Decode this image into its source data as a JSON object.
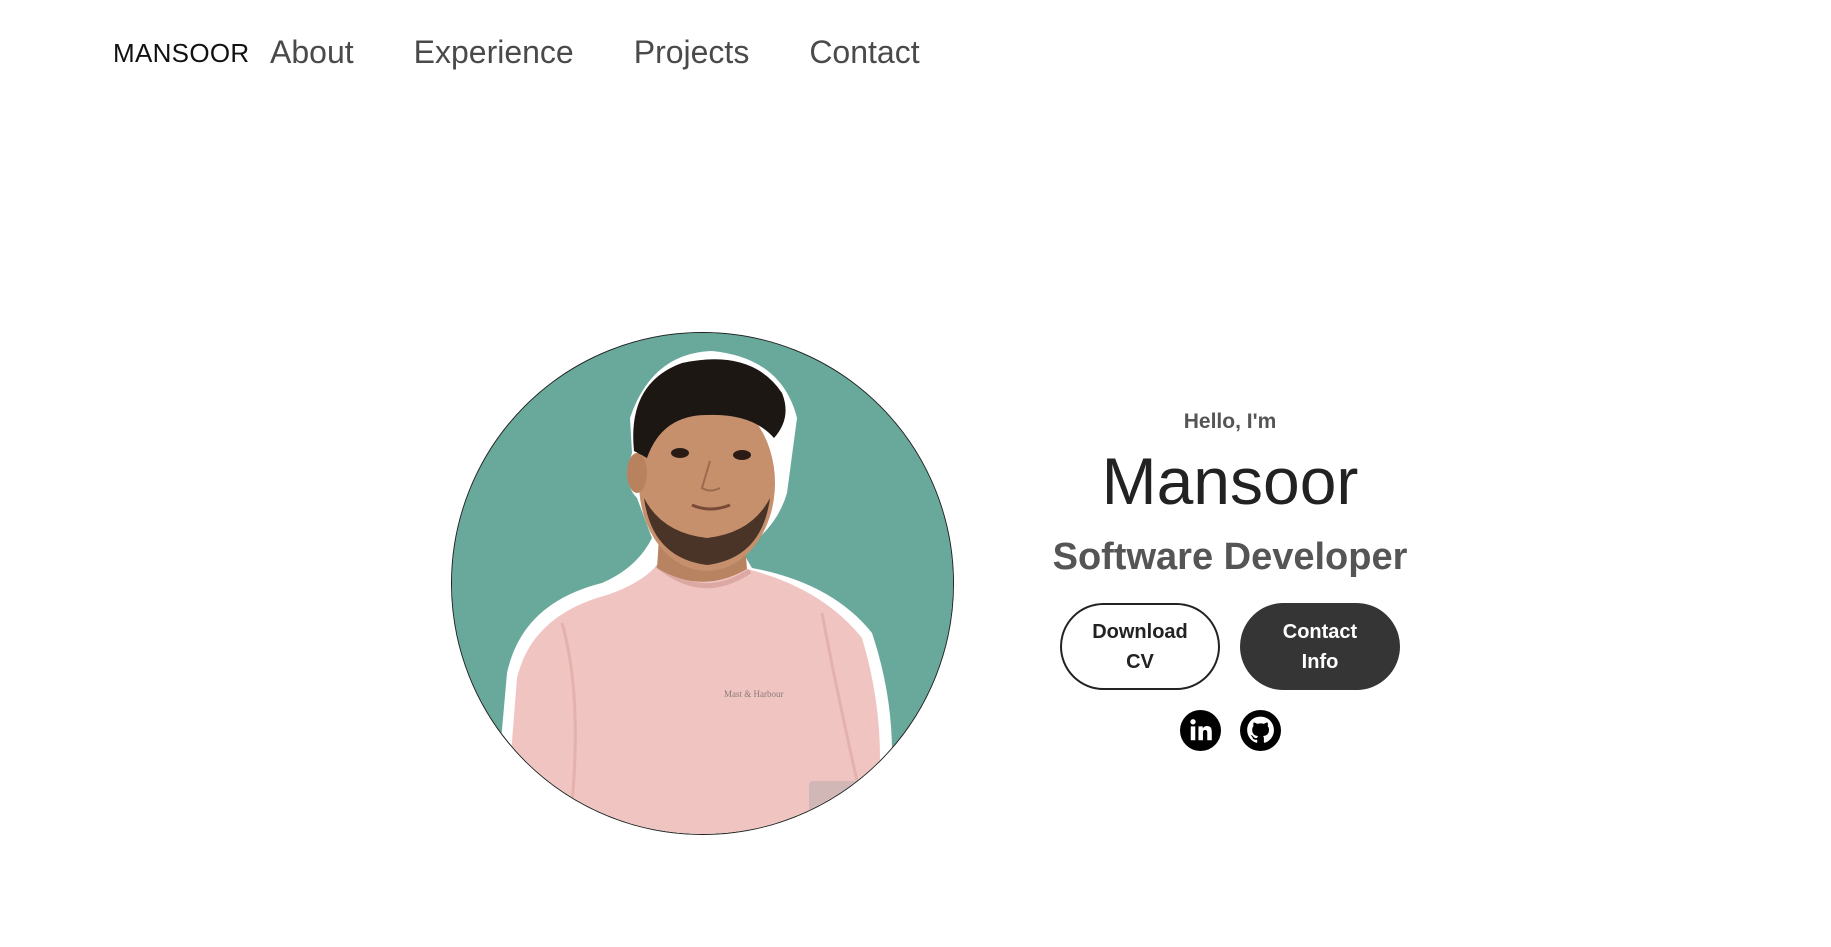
{
  "nav": {
    "logo": "MANSOOR",
    "links": [
      {
        "label": "About"
      },
      {
        "label": "Experience"
      },
      {
        "label": "Projects"
      },
      {
        "label": "Contact"
      }
    ]
  },
  "hero": {
    "greeting": "Hello, I'm",
    "name": "Mansoor",
    "title": "Software Developer",
    "buttons": {
      "download_cv": "Download CV",
      "contact_info": "Contact Info"
    },
    "socials": [
      {
        "icon": "linkedin-icon"
      },
      {
        "icon": "github-icon"
      }
    ],
    "profile_image": {
      "background_color": "#69a99b",
      "shirt_print": "Mast & Harbour"
    }
  },
  "colors": {
    "background": "#ffffff",
    "text_dark": "#222222",
    "text_muted": "#555555",
    "button_dark": "#353535"
  }
}
